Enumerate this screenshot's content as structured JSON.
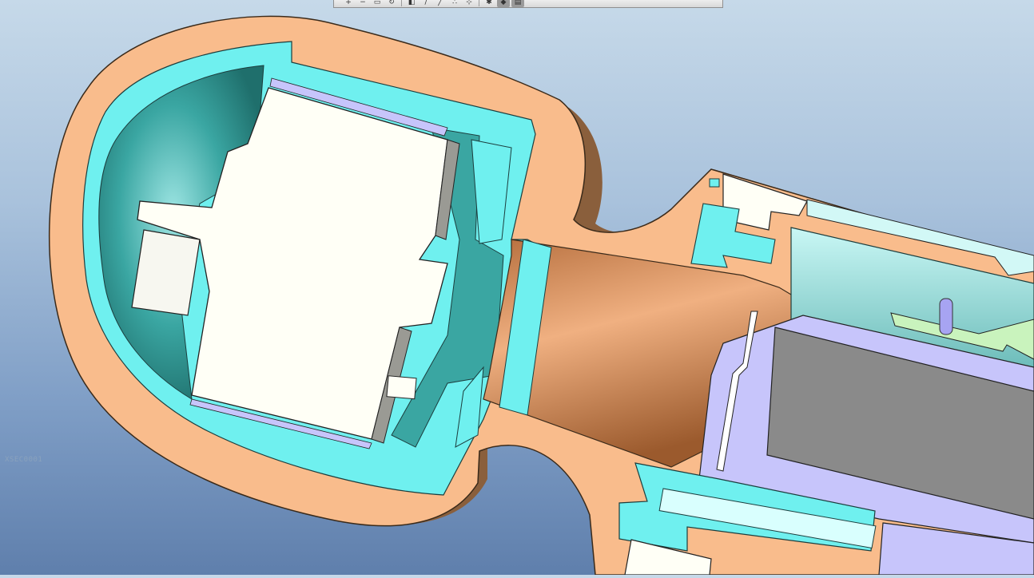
{
  "viewport": {
    "section_label": "XSEC0001",
    "background_colors": [
      "#c6d9e9",
      "#5f7fac"
    ]
  },
  "toolbar": {
    "buttons": [
      {
        "name": "zoom-in-icon",
        "glyph": "+"
      },
      {
        "name": "zoom-out-icon",
        "glyph": "−"
      },
      {
        "name": "refit-icon",
        "glyph": "▭"
      },
      {
        "name": "reorient-icon",
        "glyph": "↻"
      },
      {
        "name": "repaint-icon",
        "glyph": "◧"
      },
      {
        "name": "datum-planes-icon",
        "glyph": "/"
      },
      {
        "name": "datum-axes-icon",
        "glyph": "╱"
      },
      {
        "name": "point-display-icon",
        "glyph": "∴"
      },
      {
        "name": "csys-display-icon",
        "glyph": "⊹"
      },
      {
        "name": "spin-center-icon",
        "glyph": "✱"
      },
      {
        "name": "shading-icon",
        "glyph": "◆"
      },
      {
        "name": "saved-views-icon",
        "glyph": "▤"
      }
    ]
  },
  "model_colors": {
    "housing": "#f9bc8c",
    "housing_shadow": "#8a5f3c",
    "inner_shell": "#6ff0ef",
    "cavity": "#2b8c88",
    "core": "#fffff6",
    "shaft": "#d9905c",
    "plate": "#c7c5fb",
    "block": "#8a8a8a",
    "pcb": "#c9f3bd"
  }
}
